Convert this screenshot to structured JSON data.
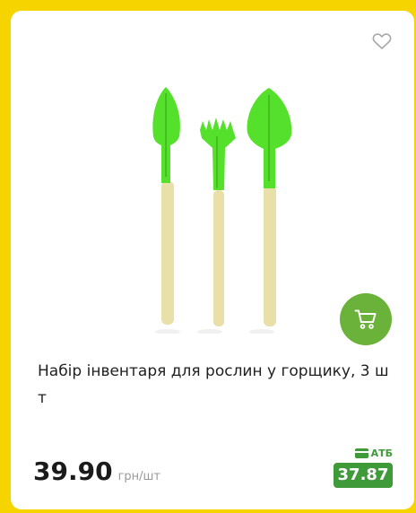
{
  "product": {
    "title": "Набір інвентаря для рослин у горщику, 3 шт",
    "price": "39.90",
    "unit": "грн/шт",
    "promo_label": "АТБ",
    "promo_price": "37.87"
  },
  "icons": {
    "favorite": "heart-outline-icon",
    "cart": "shopping-cart-icon",
    "promo": "card-icon"
  },
  "colors": {
    "background": "#f6d400",
    "accent_green": "#3f9a3a",
    "cart_button": "#6ab23a"
  }
}
